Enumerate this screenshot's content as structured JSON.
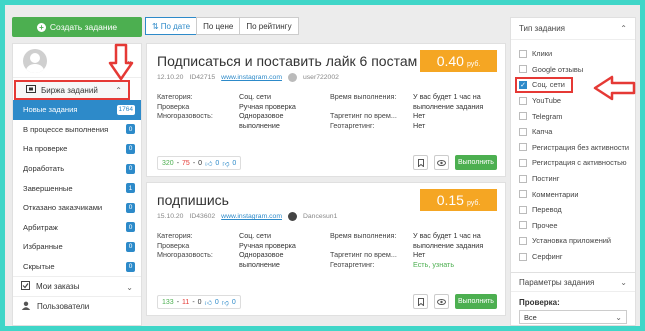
{
  "header": {
    "create_label": "Создать задание"
  },
  "sort": {
    "options": [
      {
        "label": "По дате",
        "active": true
      },
      {
        "label": "По цене",
        "active": false
      },
      {
        "label": "По рейтингу",
        "active": false
      }
    ]
  },
  "sidebar": {
    "section_label": "Биржа заданий",
    "items": [
      {
        "label": "Новые задания",
        "count": "1764",
        "active": true
      },
      {
        "label": "В процессе выполнения",
        "count": "0"
      },
      {
        "label": "На проверке",
        "count": "0"
      },
      {
        "label": "Доработать",
        "count": "0"
      },
      {
        "label": "Завершенные",
        "count": "1"
      },
      {
        "label": "Отказано заказчиками",
        "count": "0"
      },
      {
        "label": "Арбитраж",
        "count": "0"
      },
      {
        "label": "Избранные",
        "count": "0"
      },
      {
        "label": "Скрытые",
        "count": "0"
      }
    ],
    "my_orders": "Мои заказы",
    "users": "Пользователи"
  },
  "tasks": [
    {
      "title": "Подписаться и поставить лайк 6 постам",
      "price": "0.40",
      "currency": "руб.",
      "date": "12.10.20",
      "id": "ID42715",
      "site": "www.instagram.com",
      "user": "user722002",
      "category_k": "Категория:",
      "category_v": "Соц. сети",
      "check_k": "Проверка",
      "check_v": "Ручная проверка",
      "multi_k": "Многоразовость:",
      "multi_v": "Одноразовое выполнение",
      "time_k": "Время выполнения:",
      "time_v": "У вас будет 1 час на выполнение задания",
      "target_k": "Таргетинг по врем...",
      "target_v": "Нет",
      "geo_k": "Геотаргетинг:",
      "geo_v": "Нет",
      "stat_done": "320",
      "stat_fail": "75",
      "stat_pending": "0",
      "likes": "0",
      "dislikes": "0",
      "run_label": "Выполнить"
    },
    {
      "title": "подпишись",
      "price": "0.15",
      "currency": "руб.",
      "date": "15.10.20",
      "id": "ID43602",
      "site": "www.instagram.com",
      "user": "Dancesun1",
      "category_k": "Категория:",
      "category_v": "Соц. сети",
      "check_k": "Проверка",
      "check_v": "Ручная проверка",
      "multi_k": "Многоразовость:",
      "multi_v": "Одноразовое выполнение",
      "time_k": "Время выполнения:",
      "time_v": "У вас будет 1 час на выполнение задания",
      "target_k": "Таргетинг по врем...",
      "target_v": "Нет",
      "geo_k": "Геотаргетинг:",
      "geo_v": "Есть, узнать",
      "stat_done": "133",
      "stat_fail": "11",
      "stat_pending": "0",
      "likes": "0",
      "dislikes": "0",
      "run_label": "Выполнить"
    }
  ],
  "filters": {
    "title": "Тип задания",
    "types": [
      {
        "label": "Клики",
        "checked": false
      },
      {
        "label": "Google отзывы",
        "checked": false
      },
      {
        "label": "Соц. сети",
        "checked": true
      },
      {
        "label": "YouTube",
        "checked": false
      },
      {
        "label": "Telegram",
        "checked": false
      },
      {
        "label": "Капча",
        "checked": false
      },
      {
        "label": "Регистрация без активности",
        "checked": false
      },
      {
        "label": "Регистрация с активностью",
        "checked": false
      },
      {
        "label": "Постинг",
        "checked": false
      },
      {
        "label": "Комментарии",
        "checked": false
      },
      {
        "label": "Перевод",
        "checked": false
      },
      {
        "label": "Прочее",
        "checked": false
      },
      {
        "label": "Установка приложений",
        "checked": false
      },
      {
        "label": "Серфинг",
        "checked": false
      }
    ],
    "params_title": "Параметры задания",
    "check_label": "Проверка:",
    "check_value": "Все"
  },
  "colors": {
    "accent": "#2d8ac9",
    "green": "#4caf50",
    "price": "#f5a623",
    "highlight": "#e53935",
    "frame": "#40d6c8"
  }
}
